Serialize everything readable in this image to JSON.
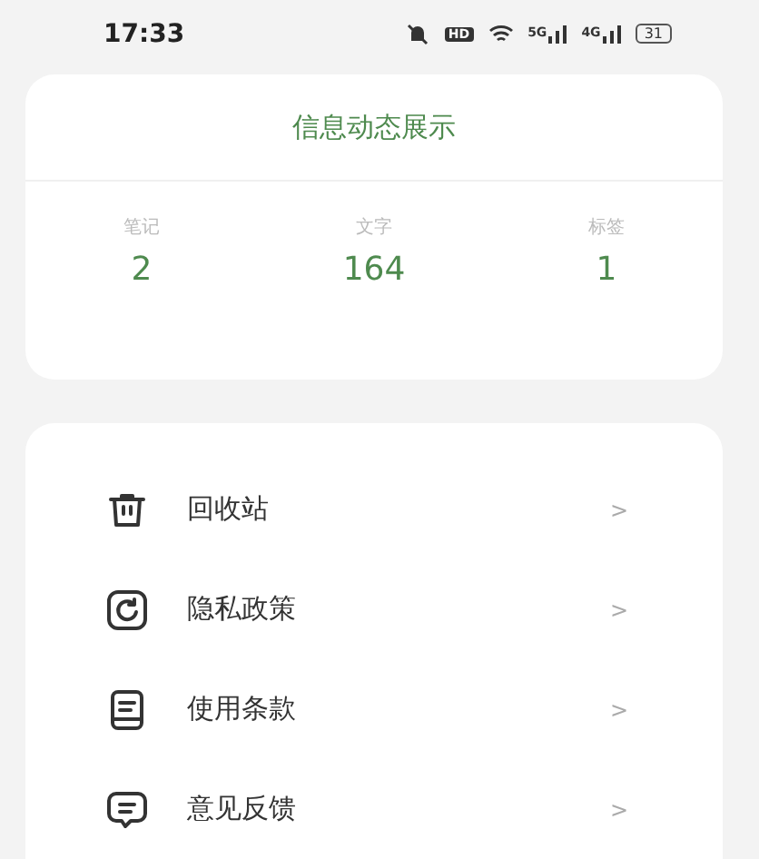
{
  "status_bar": {
    "time": "17:33",
    "hd": "HD",
    "signals": [
      "5G",
      "4G"
    ],
    "battery": "31"
  },
  "stats_card": {
    "title": "信息动态展示",
    "stats": [
      {
        "label": "笔记",
        "value": "2"
      },
      {
        "label": "文字",
        "value": "164"
      },
      {
        "label": "标签",
        "value": "1"
      }
    ]
  },
  "menu": [
    {
      "kind": "trash",
      "label": "回收站",
      "chevron": ">"
    },
    {
      "kind": "privacy",
      "label": "隐私政策",
      "chevron": ">"
    },
    {
      "kind": "terms",
      "label": "使用条款",
      "chevron": ">"
    },
    {
      "kind": "feedback",
      "label": "意见反馈",
      "chevron": ">"
    }
  ]
}
